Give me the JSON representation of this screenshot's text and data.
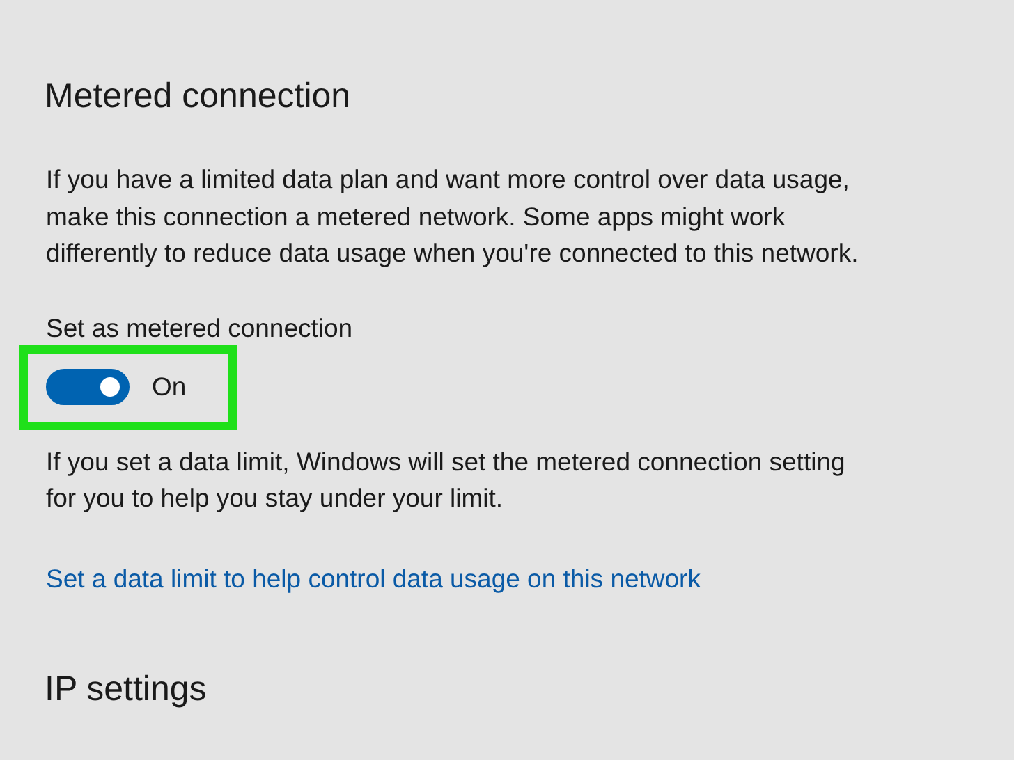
{
  "section": {
    "title": "Metered connection",
    "description": "If you have a limited data plan and want more control over data usage, make this connection a metered network. Some apps might work differently to reduce data usage when you're connected to this network.",
    "toggle": {
      "label": "Set as metered connection",
      "on": true,
      "state_text": "On",
      "highlighted": true
    },
    "note": "If you set a data limit, Windows will set the metered connection setting for you to help you stay under your limit.",
    "link": "Set a data limit to help control data usage on this network"
  },
  "next_section": {
    "title": "IP settings"
  }
}
